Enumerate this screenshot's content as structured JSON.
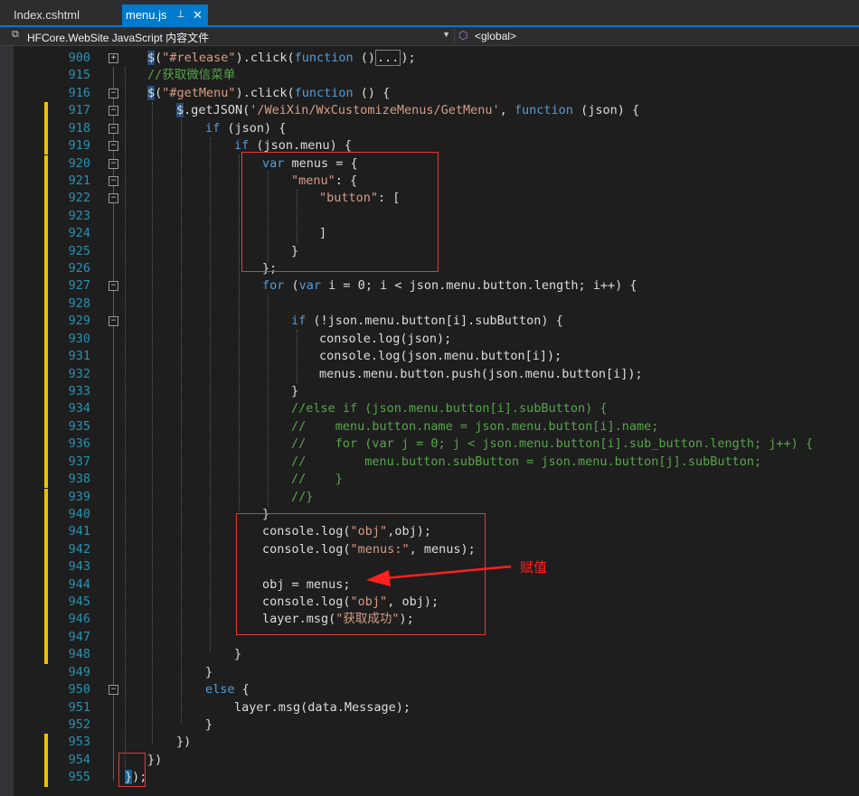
{
  "tabs": [
    {
      "label": "Index.cshtml",
      "active": false
    },
    {
      "label": "menu.js",
      "active": true,
      "pin": "⊥",
      "close": "✕"
    }
  ],
  "nav": {
    "project": "HFCore.WebSite JavaScript 内容文件",
    "scope": "<global>"
  },
  "annotation": {
    "text": "赋值",
    "color": "#ff2020"
  },
  "lines": [
    {
      "n": "900",
      "fold": "+",
      "chg": false
    },
    {
      "n": "915",
      "fold": "",
      "chg": false
    },
    {
      "n": "916",
      "fold": "−",
      "chg": false
    },
    {
      "n": "917",
      "fold": "−",
      "chg": true
    },
    {
      "n": "918",
      "fold": "−",
      "chg": true
    },
    {
      "n": "919",
      "fold": "−",
      "chg": true
    },
    {
      "n": "920",
      "fold": "−",
      "chg": true
    },
    {
      "n": "921",
      "fold": "−",
      "chg": true
    },
    {
      "n": "922",
      "fold": "−",
      "chg": true
    },
    {
      "n": "923",
      "fold": "",
      "chg": true
    },
    {
      "n": "924",
      "fold": "",
      "chg": true
    },
    {
      "n": "925",
      "fold": "",
      "chg": true
    },
    {
      "n": "926",
      "fold": "",
      "chg": true
    },
    {
      "n": "927",
      "fold": "−",
      "chg": true
    },
    {
      "n": "928",
      "fold": "",
      "chg": true
    },
    {
      "n": "929",
      "fold": "−",
      "chg": true
    },
    {
      "n": "930",
      "fold": "",
      "chg": true
    },
    {
      "n": "931",
      "fold": "",
      "chg": true
    },
    {
      "n": "932",
      "fold": "",
      "chg": true
    },
    {
      "n": "933",
      "fold": "",
      "chg": true
    },
    {
      "n": "934",
      "fold": "",
      "chg": true
    },
    {
      "n": "935",
      "fold": "",
      "chg": true
    },
    {
      "n": "936",
      "fold": "",
      "chg": true
    },
    {
      "n": "937",
      "fold": "",
      "chg": true
    },
    {
      "n": "938",
      "fold": "",
      "chg": true
    },
    {
      "n": "939",
      "fold": "",
      "chg": true
    },
    {
      "n": "940",
      "fold": "",
      "chg": true
    },
    {
      "n": "941",
      "fold": "",
      "chg": true
    },
    {
      "n": "942",
      "fold": "",
      "chg": true
    },
    {
      "n": "943",
      "fold": "",
      "chg": true
    },
    {
      "n": "944",
      "fold": "",
      "chg": true
    },
    {
      "n": "945",
      "fold": "",
      "chg": true
    },
    {
      "n": "946",
      "fold": "",
      "chg": true
    },
    {
      "n": "947",
      "fold": "",
      "chg": true
    },
    {
      "n": "948",
      "fold": "",
      "chg": true
    },
    {
      "n": "949",
      "fold": "",
      "chg": false
    },
    {
      "n": "950",
      "fold": "−",
      "chg": false
    },
    {
      "n": "951",
      "fold": "",
      "chg": false
    },
    {
      "n": "952",
      "fold": "",
      "chg": false
    },
    {
      "n": "953",
      "fold": "",
      "chg": true
    },
    {
      "n": "954",
      "fold": "",
      "chg": true
    },
    {
      "n": "955",
      "fold": "",
      "chg": true
    }
  ],
  "code": {
    "l900": {
      "a": "$",
      "b": "(",
      "c": "\"#release\"",
      "d": ").click(",
      "e": "function",
      "f": " ()",
      "g": "...",
      "h": ");"
    },
    "l915": {
      "a": "//获取微信菜单"
    },
    "l916": {
      "a": "$",
      "b": "(",
      "c": "\"#getMenu\"",
      "d": ").click(",
      "e": "function",
      "f": " () {"
    },
    "l917": {
      "a": "$",
      "b": ".getJSON(",
      "c": "'/WeiXin/WxCustomizeMenus/GetMenu'",
      "d": ", ",
      "e": "function",
      "f": " (json) {"
    },
    "l918": {
      "a": "if",
      "b": " (json) {"
    },
    "l919": {
      "a": "if",
      "b": " (json.menu) {"
    },
    "l920": {
      "a": "var",
      "b": " menus = {"
    },
    "l921": {
      "a": "\"menu\"",
      "b": ": {"
    },
    "l922": {
      "a": "\"button\"",
      "b": ": ["
    },
    "l924": {
      "a": "]"
    },
    "l925": {
      "a": "}"
    },
    "l926": {
      "a": "};"
    },
    "l927": {
      "a": "for",
      "b": " (",
      "c": "var",
      "d": " i = 0; i < json.menu.button.length; i++) {"
    },
    "l929": {
      "a": "if",
      "b": " (!json.menu.button[i].subButton) {"
    },
    "l930": {
      "a": "console.log(json);"
    },
    "l931": {
      "a": "console.log(json.menu.button[i]);"
    },
    "l932": {
      "a": "menus.menu.button.push(json.menu.button[i]);"
    },
    "l933": {
      "a": "}"
    },
    "l934": {
      "a": "//else if (json.menu.button[i].subButton) {"
    },
    "l935": {
      "a": "//    menu.button.name = json.menu.button[i].name;"
    },
    "l936": {
      "a": "//    for (var j = 0; j < json.menu.button[i].sub_button.length; j++) {"
    },
    "l937": {
      "a": "//        menu.button.subButton = json.menu.button[j].subButton;"
    },
    "l938": {
      "a": "//    }"
    },
    "l939": {
      "a": "//}"
    },
    "l940": {
      "a": "}"
    },
    "l941": {
      "a": "console.log(",
      "b": "\"obj\"",
      "c": ",obj);"
    },
    "l942": {
      "a": "console.log(",
      "b": "\"menus:\"",
      "c": ", menus);"
    },
    "l944": {
      "a": "obj = menus;"
    },
    "l945": {
      "a": "console.log(",
      "b": "\"obj\"",
      "c": ", obj);"
    },
    "l946": {
      "a": "layer.msg(",
      "b": "\"获取成功\"",
      "c": ");"
    },
    "l948": {
      "a": "}"
    },
    "l949": {
      "a": "}"
    },
    "l950": {
      "a": "else",
      "b": " {"
    },
    "l951": {
      "a": "layer.msg(data.Message);"
    },
    "l952": {
      "a": "}"
    },
    "l953": {
      "a": "})"
    },
    "l954": {
      "a": "})"
    },
    "l955": {
      "a": "}",
      "b": ");"
    }
  },
  "colors": {
    "keyword": "#569cd6",
    "string": "#d69d85",
    "comment": "#57a64a",
    "line_number": "#2b91af",
    "change_bar": "#efc000",
    "tab_active": "#007acc"
  }
}
